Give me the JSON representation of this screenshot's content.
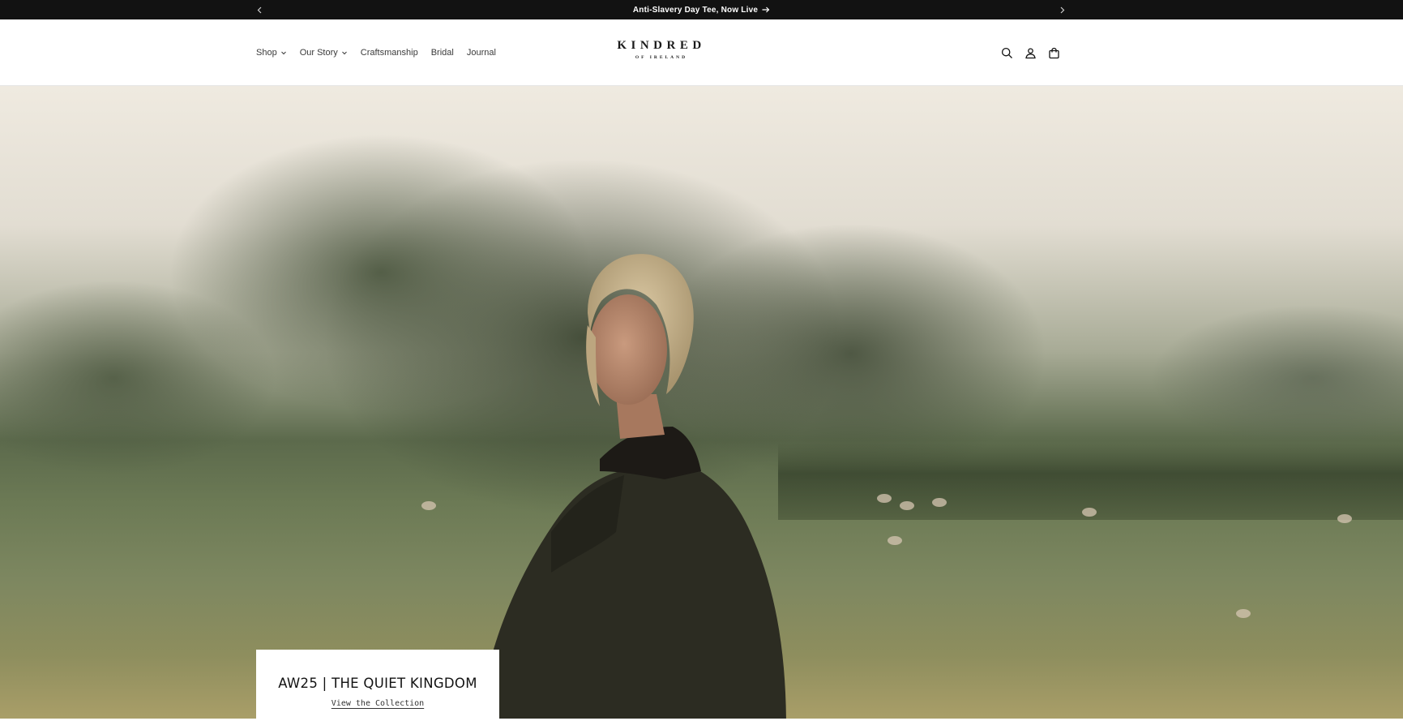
{
  "announcement": {
    "message": "Anti-Slavery Day Tee, Now Live",
    "prev_icon": "chevron-left-icon",
    "next_icon": "chevron-right-icon",
    "arrow_icon": "arrow-right-icon"
  },
  "header": {
    "nav": [
      {
        "label": "Shop",
        "has_dropdown": true
      },
      {
        "label": "Our Story",
        "has_dropdown": true
      },
      {
        "label": "Craftsmanship",
        "has_dropdown": false
      },
      {
        "label": "Bridal",
        "has_dropdown": false
      },
      {
        "label": "Journal",
        "has_dropdown": false
      }
    ],
    "logo": {
      "main": "KINDRED",
      "sub": "OF IRELAND"
    },
    "icons": [
      "search-icon",
      "account-icon",
      "cart-icon"
    ]
  },
  "hero": {
    "title": "AW25 | THE QUIET KINGDOM",
    "link_label": "View the Collection"
  },
  "colors": {
    "announcement_bg": "#121212",
    "text": "#121212",
    "header_bg": "#ffffff"
  }
}
